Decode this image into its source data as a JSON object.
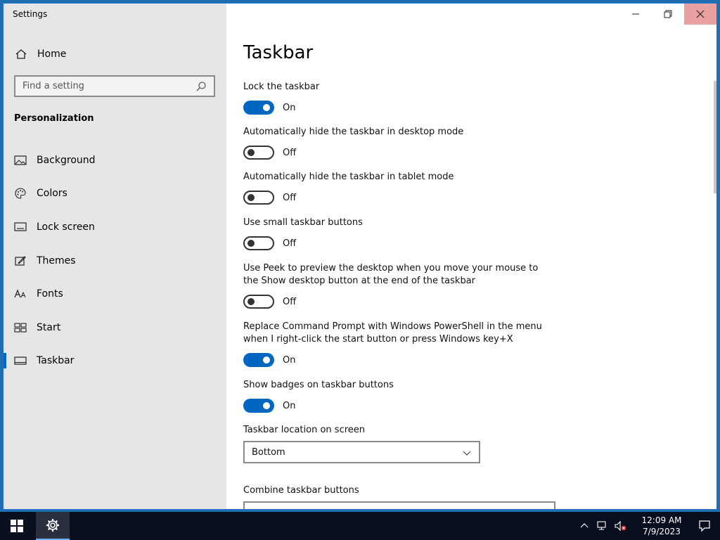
{
  "window": {
    "title": "Settings"
  },
  "sidebar": {
    "home_label": "Home",
    "search_placeholder": "Find a setting",
    "section_title": "Personalization",
    "items": [
      {
        "label": "Background",
        "icon": "picture-icon"
      },
      {
        "label": "Colors",
        "icon": "palette-icon"
      },
      {
        "label": "Lock screen",
        "icon": "lock-screen-icon"
      },
      {
        "label": "Themes",
        "icon": "themes-icon"
      },
      {
        "label": "Fonts",
        "icon": "fonts-icon"
      },
      {
        "label": "Start",
        "icon": "start-icon"
      },
      {
        "label": "Taskbar",
        "icon": "taskbar-icon",
        "active": true
      }
    ]
  },
  "page": {
    "title": "Taskbar",
    "settings": [
      {
        "label": "Lock the taskbar",
        "state": "On"
      },
      {
        "label": "Automatically hide the taskbar in desktop mode",
        "state": "Off"
      },
      {
        "label": "Automatically hide the taskbar in tablet mode",
        "state": "Off"
      },
      {
        "label": "Use small taskbar buttons",
        "state": "Off"
      },
      {
        "label": "Use Peek to preview the desktop when you move your mouse to the Show desktop button at the end of the taskbar",
        "state": "Off"
      },
      {
        "label": "Replace Command Prompt with Windows PowerShell in the menu when I right-click the start button or press Windows key+X",
        "state": "On"
      },
      {
        "label": "Show badges on taskbar buttons",
        "state": "On"
      }
    ],
    "location_label": "Taskbar location on screen",
    "location_value": "Bottom",
    "combine_label": "Combine taskbar buttons"
  },
  "taskbar": {
    "time": "12:09 AM",
    "date": "7/9/2023"
  },
  "colors": {
    "accent": "#0067c0",
    "sidebar_bg": "#e6e6e6",
    "taskbar_bg": "#0a0f1f",
    "close_hover": "#e8a0a0"
  }
}
